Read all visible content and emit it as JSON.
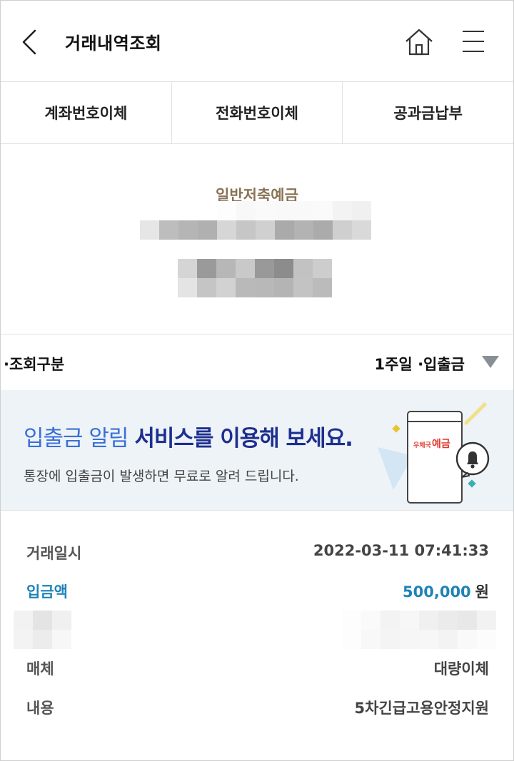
{
  "header": {
    "title": "거래내역조회",
    "back_icon": "chevron-left-icon",
    "home_icon": "home-icon",
    "menu_icon": "hamburger-menu-icon"
  },
  "tabs": [
    {
      "label": "계좌번호이체"
    },
    {
      "label": "전화번호이체"
    },
    {
      "label": "공과금납부"
    }
  ],
  "account": {
    "name": "일반저축예금",
    "number_masked": true,
    "balance_masked": true
  },
  "filter": {
    "label": "·조회구분",
    "value": "1주일 ·입출금",
    "arrow_icon": "triangle-down-icon"
  },
  "banner": {
    "headline_part1": "입출금 알림",
    "headline_part2": "서비스를 이용해 보세요.",
    "subtext": "통장에 입출금이 발생하면 무료로 알려 드립니다.",
    "brand_text": "우체국 예금",
    "colors": {
      "accent_light": "#3a6fd8",
      "accent_dark": "#1e2f8f",
      "brand": "#e2352b",
      "background": "#edf3f7"
    }
  },
  "transaction": {
    "datetime_label": "거래일시",
    "datetime_value": "2022-03-11 07:41:33",
    "deposit_label": "입금액",
    "deposit_value": "500,000",
    "deposit_unit": "원",
    "medium_label": "매체",
    "medium_value": "대량이체",
    "content_label": "내용",
    "content_value": "5차긴급고용안정지원",
    "colors": {
      "deposit": "#1f83b8"
    }
  }
}
